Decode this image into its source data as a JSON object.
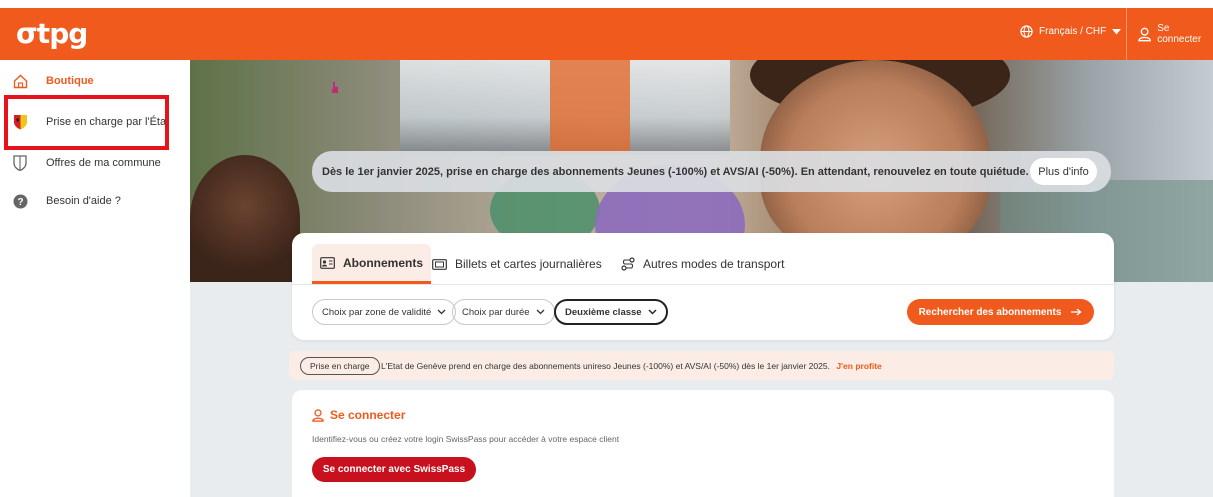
{
  "header": {
    "logo": "σtpg",
    "language": "Français / CHF",
    "login": "Se connecter",
    "brand_color": "#f05a1c"
  },
  "sidebar": {
    "items": [
      {
        "label": "Boutique",
        "icon": "home-icon",
        "active": true
      },
      {
        "label": "Prise en charge par l'État",
        "icon": "geneva-shield-icon"
      },
      {
        "label": "Offres de ma commune",
        "icon": "shield-outline-icon"
      },
      {
        "label": "Besoin d'aide ?",
        "icon": "help-circle-icon"
      }
    ]
  },
  "hero": {
    "announcement": "Dès le 1er janvier 2025, prise en charge des abonnements Jeunes (-100%) et AVS/AI (-50%). En attendant, renouvelez en toute quiétude.",
    "info_button": "Plus d'info"
  },
  "search": {
    "tabs": [
      {
        "label": "Abonnements",
        "icon": "id-card-icon",
        "active": true
      },
      {
        "label": "Billets et cartes journalières",
        "icon": "ticket-icon"
      },
      {
        "label": "Autres modes de transport",
        "icon": "route-icon"
      }
    ],
    "filters": [
      "Choix par zone de validité",
      "Choix par durée",
      "Deuxième classe"
    ],
    "search_button": "Rechercher des abonnements"
  },
  "notice": {
    "badge": "Prise en charge",
    "text": "L'Etat de Genève prend en charge des abonnements unireso Jeunes (-100%) et AVS/AI (-50%) dès le 1er janvier 2025.",
    "link": "J'en profite"
  },
  "login_card": {
    "title": "Se connecter",
    "description": "Identifiez-vous ou créez votre login SwissPass pour accéder à votre espace client",
    "button": "Se connecter avec SwissPass"
  }
}
